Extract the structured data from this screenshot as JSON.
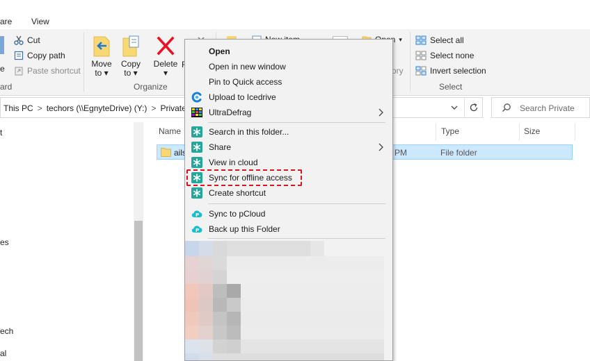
{
  "ribbon_tabs": [
    "are",
    "View"
  ],
  "ribbon": {
    "clipboard": {
      "cut": "Cut",
      "copy_path": "Copy path",
      "paste_shortcut": "Paste shortcut",
      "group_label_fragment": "ard",
      "left_fragment": "e"
    },
    "organize": {
      "move_to_line1": "Move",
      "move_to_line2": "to",
      "copy_to_line1": "Copy",
      "copy_to_line2": "to",
      "delete": "Delete",
      "rename_fragment": "R",
      "group_label": "Organize"
    },
    "new": {
      "new_item": "New item"
    },
    "open": {
      "open": "Open",
      "history_fragment": "ory"
    },
    "select": {
      "select_all": "Select all",
      "select_none": "Select none",
      "invert_selection": "Invert selection",
      "group_label": "Select"
    }
  },
  "address": {
    "crumbs": [
      "This PC",
      "techors (\\\\EgnyteDrive) (Y:)",
      "Private"
    ],
    "separator": ">"
  },
  "search": {
    "placeholder": "Search Private"
  },
  "nav_pane": {
    "fragments": [
      "t",
      "es",
      "ech",
      "al"
    ]
  },
  "file_list": {
    "columns": {
      "name": "Name",
      "type": "Type",
      "size": "Size"
    },
    "rows": [
      {
        "name": "ails",
        "date_fragment": "PM",
        "type": "File folder"
      }
    ]
  },
  "context_menu": {
    "items": [
      {
        "label": "Open",
        "bold": true,
        "icon": "none"
      },
      {
        "label": "Open in new window",
        "icon": "none"
      },
      {
        "label": "Pin to Quick access",
        "icon": "none"
      },
      {
        "label": "Upload to Icedrive",
        "icon": "icedrive-icon"
      },
      {
        "label": "UltraDefrag",
        "icon": "ultradefrag-icon",
        "submenu": true
      },
      {
        "label": "Search in this folder...",
        "icon": "egnyte-icon"
      },
      {
        "label": "Share",
        "icon": "egnyte-icon",
        "submenu": true
      },
      {
        "label": "View in cloud",
        "icon": "egnyte-icon"
      },
      {
        "label": "Sync for offline access",
        "icon": "egnyte-icon",
        "highlighted": true
      },
      {
        "label": "Create shortcut",
        "icon": "egnyte-icon"
      },
      {
        "label": "Sync to pCloud",
        "icon": "pcloud-icon"
      },
      {
        "label": "Back up this Folder",
        "icon": "pcloud-icon"
      }
    ]
  },
  "colors": {
    "highlight_dash": "#d8141e",
    "selected_row": "#cce8ff",
    "egnyte_teal": "#26a69a",
    "pcloud_cyan": "#17bed0",
    "delete_red": "#e81123"
  }
}
